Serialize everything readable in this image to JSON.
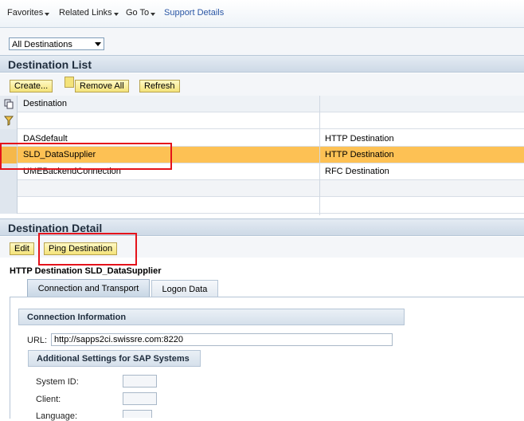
{
  "menu": {
    "favorites": "Favorites",
    "related_links": "Related Links",
    "go_to": "Go To",
    "support_details": "Support Details"
  },
  "filter": {
    "selected": "All Destinations"
  },
  "destination_list": {
    "title": "Destination List",
    "buttons": {
      "create": "Create...",
      "remove_all": "Remove All",
      "refresh": "Refresh"
    },
    "columns": {
      "destination": "Destination",
      "type": ""
    },
    "rows": [
      {
        "name": "DASdefault",
        "type": "HTTP Destination"
      },
      {
        "name": "SLD_DataSupplier",
        "type": "HTTP Destination"
      },
      {
        "name": "UMEBackendConnection",
        "type": "RFC Destination"
      }
    ]
  },
  "destination_detail": {
    "title": "Destination Detail",
    "buttons": {
      "edit": "Edit",
      "ping": "Ping Destination"
    },
    "heading": "HTTP Destination SLD_DataSupplier",
    "tabs": {
      "connection": "Connection and Transport",
      "logon": "Logon Data"
    },
    "connection_info": "Connection Information",
    "url_label": "URL:",
    "url_value": "http://sapps2ci.swissre.com:8220",
    "additional_settings": "Additional Settings for SAP Systems",
    "system_id_label": "System ID:",
    "client_label": "Client:",
    "language_label": "Language:"
  },
  "colors": {
    "highlight": "#fdc154",
    "annotation_red": "#e4131b",
    "button_yellow": "#f4e37a"
  }
}
